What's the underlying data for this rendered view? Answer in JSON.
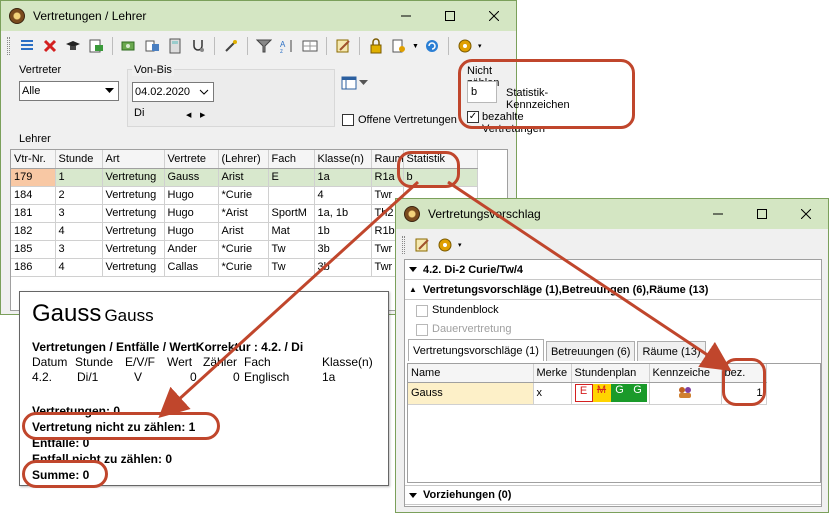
{
  "win1": {
    "title": "Vertretungen / Lehrer",
    "vertreter_label": "Vertreter",
    "vertreter_value": "Alle",
    "vonbis_label": "Von-Bis",
    "date_value": "04.02.2020",
    "weekday": "Di",
    "offene_label": "Offene Vertretungen",
    "nicht_zaehlen_label": "Nicht zählen",
    "kennzeichen_value": "b",
    "kennzeichen_label": "Statistik-Kennzeichen",
    "bezahlte_label": "bezahlte Vertretungen",
    "bezahlte_checked": "✓",
    "lehrer_label": "Lehrer",
    "columns": [
      "Vtr-Nr.",
      "Stunde",
      "Art",
      "Vertrete",
      "(Lehrer)",
      "Fach",
      "Klasse(n)",
      "Raum",
      "Statistik"
    ],
    "rows": [
      [
        "179",
        "1",
        "Vertretung",
        "Gauss",
        "Arist",
        "E",
        "1a",
        "R1a",
        "b"
      ],
      [
        "184",
        "2",
        "Vertretung",
        "Hugo",
        "*Curie",
        "",
        "4",
        "Twr",
        ""
      ],
      [
        "181",
        "3",
        "Vertretung",
        "Hugo",
        "*Arist",
        "SportM",
        "1a, 1b",
        "Th2",
        ""
      ],
      [
        "182",
        "4",
        "Vertretung",
        "Hugo",
        "Arist",
        "Mat",
        "1b",
        "R1b",
        ""
      ],
      [
        "185",
        "3",
        "Vertretung",
        "Ander",
        "*Curie",
        "Tw",
        "3b",
        "Twr",
        ""
      ],
      [
        "186",
        "4",
        "Vertretung",
        "Callas",
        "*Curie",
        "Tw",
        "3b",
        "Twr",
        ""
      ]
    ]
  },
  "win2": {
    "title": "Vertretungsvorschlag",
    "section1": "4.2. Di-2 Curie/Tw/4",
    "section2": "Vertretungsvorschläge (1),Betreuungen (6),Räume (13)",
    "stundenblock": "Stundenblock",
    "dauervertretung": "Dauervertretung",
    "tabs": [
      "Vertretungsvorschläge (1)",
      "Betreuungen (6)",
      "Räume (13)"
    ],
    "columns": [
      "Name",
      "Merke",
      "Stundenplan",
      "Kennzeiche",
      "bez."
    ],
    "row": {
      "name": "Gauss",
      "merke": "x",
      "sp1": "E",
      "sp2": "M",
      "sp3": "G",
      "sp4": "G",
      "bez": "1"
    },
    "section3": "Vorziehungen (0)"
  },
  "popup": {
    "name_big": "Gauss",
    "name_small": "Gauss",
    "header_line": "Vertretungen / Entfälle / WertKorrektur : 4.2. / Di",
    "cols": [
      "Datum",
      "Stunde",
      "E/V/F",
      "Wert",
      "Zähler",
      "Fach",
      "Klasse(n)"
    ],
    "vals": [
      "4.2.",
      "Di/1",
      "V",
      "0",
      "0",
      "Englisch",
      "1a"
    ],
    "vertretungen": "Vertretungen: 0",
    "nicht_zaehlen": "Vertretung nicht zu zählen: 1",
    "entfaelle": "Entfälle: 0",
    "entfall_nicht": "Entfall nicht zu zählen: 0",
    "summe": "Summe: 0"
  },
  "colors": {
    "titlebar": "#d4e6c3",
    "highlight_row": "#d8e8cd",
    "selected_cell": "#f8c8a4",
    "annotation_red": "#c0462c",
    "plan_green": "#1a9a2a"
  }
}
